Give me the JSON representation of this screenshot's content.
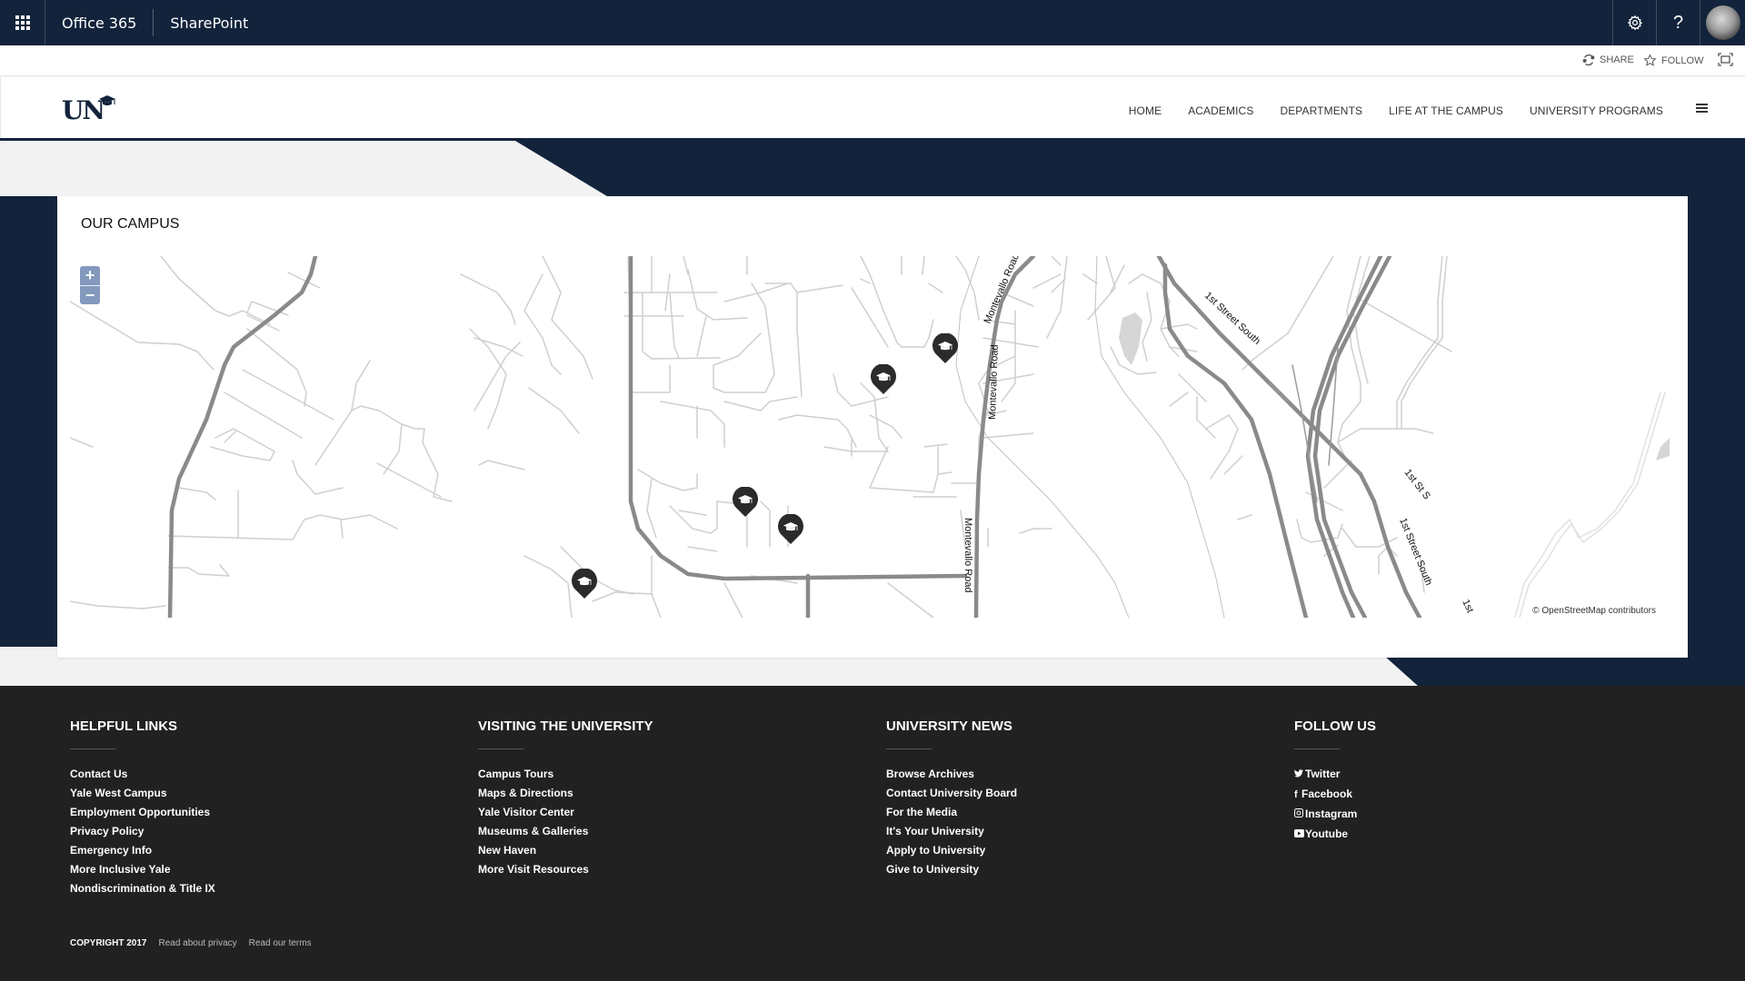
{
  "suitebar": {
    "app_name": "Office 365",
    "product": "SharePoint",
    "settings_icon": "gear-icon",
    "help_label": "?",
    "avatar": "user-avatar"
  },
  "actions": {
    "share": "SHARE",
    "follow": "FOLLOW",
    "focus_icon": "fullscreen-icon"
  },
  "header": {
    "logo": "UN",
    "nav": [
      "HOME",
      "ACADEMICS",
      "DEPARTMENTS",
      "LIFE AT THE CAMPUS",
      "UNIVERSITY PROGRAMS"
    ],
    "menu_icon": "hamburger-icon"
  },
  "colors": {
    "brand_navy": "#12233b",
    "footer_bg": "#212121",
    "page_bg": "#f2f2f2",
    "zoom_control": "#8399bd",
    "marker": "#2b2b2b"
  },
  "campus": {
    "title": "OUR CAMPUS",
    "zoom_in": "+",
    "zoom_out": "−",
    "attribution": "© OpenStreetMap contributors",
    "road_labels": [
      "Montevallo Road",
      "Montevallo Road",
      "Montevallo Road",
      "1st Street South",
      "1st St S",
      "1st Street South",
      "1st"
    ],
    "marker_count": 5,
    "marker_icon": "graduation-cap-icon"
  },
  "footer": {
    "columns": [
      {
        "title": "HELPFUL LINKS",
        "links": [
          "Contact Us",
          "Yale West Campus",
          "Employment Opportunities",
          "Privacy Policy",
          "Emergency Info",
          "More Inclusive Yale",
          "Nondiscrimination & Title IX"
        ]
      },
      {
        "title": "VISITING THE UNIVERSITY",
        "links": [
          "Campus Tours",
          "Maps & Directions",
          "Yale Visitor Center",
          "Museums & Galleries",
          "New Haven",
          "More Visit Resources"
        ]
      },
      {
        "title": "UNIVERSITY NEWS",
        "links": [
          "Browse Archives",
          "Contact University Board",
          "For the Media",
          "It's Your University",
          "Apply to University",
          "Give to University"
        ]
      },
      {
        "title": "FOLLOW US",
        "links": [
          "Twitter",
          "Facebook",
          "Instagram",
          "Youtube"
        ],
        "icons": [
          "twitter-icon",
          "facebook-icon",
          "instagram-icon",
          "youtube-icon"
        ]
      }
    ],
    "copyright": "COPYRIGHT 2017",
    "privacy": "Read about privacy",
    "terms": "Read our terms"
  }
}
